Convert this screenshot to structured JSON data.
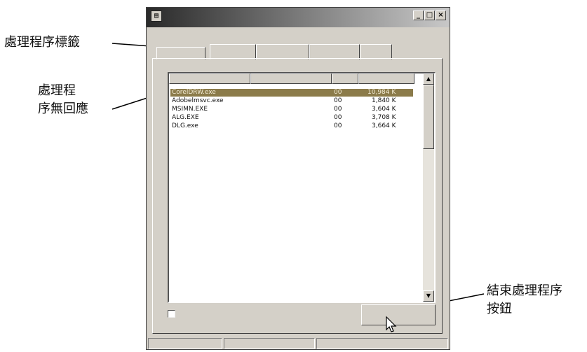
{
  "callouts": {
    "tab_label": "處理程序標籤",
    "process_label_line1": "處理程",
    "process_label_line2": "序無回應",
    "end_button_label_line1": "結束處理程序",
    "end_button_label_line2": "按鈕"
  },
  "window": {
    "caption_buttons": [
      "_",
      "□",
      "×"
    ],
    "system_icon": "window-icon"
  },
  "processes": [
    {
      "name": "CorelDRW.exe",
      "cpu": "00",
      "mem": "10,984 K",
      "selected": true
    },
    {
      "name": "Adobelmsvc.exe",
      "cpu": "00",
      "mem": "1,840 K"
    },
    {
      "name": "MSIMN.EXE",
      "cpu": "00",
      "mem": "3,604 K"
    },
    {
      "name": "ALG.EXE",
      "cpu": "00",
      "mem": "3,708 K"
    },
    {
      "name": "DLG.exe",
      "cpu": "00",
      "mem": "3,664 K"
    }
  ],
  "scroll": {
    "up": "▲",
    "down": "▼"
  },
  "colors": {
    "selection": "#8b7b4a",
    "chrome": "#d4d0c8"
  }
}
